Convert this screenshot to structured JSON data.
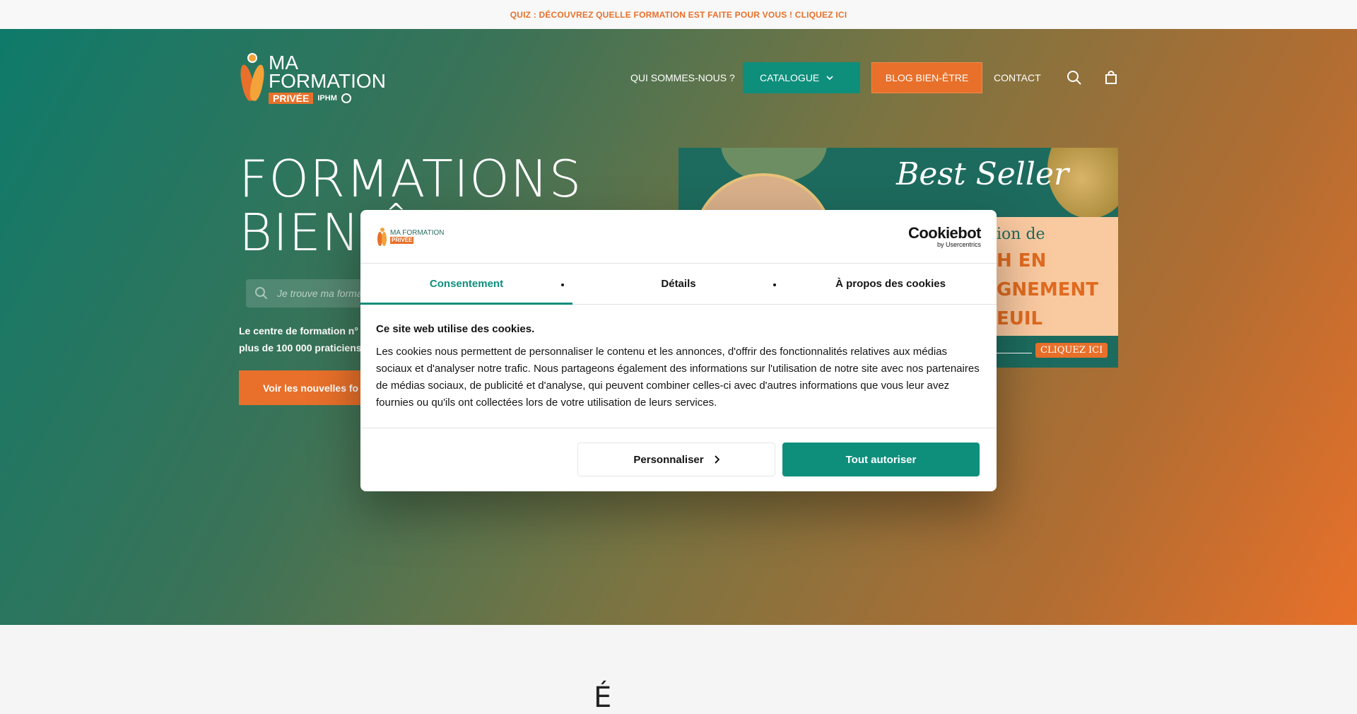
{
  "topbar": {
    "text": "QUIZ : DÉCOUVREZ QUELLE FORMATION EST FAITE POUR VOUS ! CLIQUEZ ICI"
  },
  "logo": {
    "line1": "MA",
    "line2": "FORMATION",
    "tag": "PRIVÉE",
    "badge": "IPHM"
  },
  "nav": {
    "items": [
      {
        "label": "QUI SOMMES-NOUS ?"
      },
      {
        "label": "CATALOGUE"
      },
      {
        "label": "BLOG BIEN-ÊTRE"
      },
      {
        "label": "CONTACT"
      }
    ]
  },
  "hero": {
    "title_line1": "FORMATIONS",
    "title_line2": "BIEN-Ê",
    "search_placeholder": "Je trouve ma forma",
    "desc_line1": "Le centre de formation n°",
    "desc_line2": "plus de 100 000 praticiens",
    "cta": "Voir les nouvelles fo"
  },
  "banner": {
    "best": "Best Seller",
    "line1": "ion de",
    "line2": "H EN",
    "line3": "GNEMENT",
    "line4": "EUIL",
    "cta": "CLIQUEZ ICI"
  },
  "cookie": {
    "brand": "Cookiebot",
    "brand_sub": "by Usercentrics",
    "logo_text": "MA FORMATION",
    "logo_tag": "PRIVÉE",
    "tabs": [
      "Consentement",
      "Détails",
      "À propos des cookies"
    ],
    "heading": "Ce site web utilise des cookies.",
    "body": "Les cookies nous permettent de personnaliser le contenu et les annonces, d'offrir des fonctionnalités relatives aux médias sociaux et d'analyser notre trafic. Nous partageons également des informations sur l'utilisation de notre site avec nos partenaires de médias sociaux, de publicité et d'analyse, qui peuvent combiner celles-ci avec d'autres informations que vous leur avez fournies ou qu'ils ont collectées lors de votre utilisation de leurs services.",
    "btn_customize": "Personnaliser",
    "btn_allow": "Tout autoriser"
  },
  "below": {
    "partial": "É"
  },
  "colors": {
    "teal": "#0e8f7c",
    "orange": "#e8702a"
  }
}
